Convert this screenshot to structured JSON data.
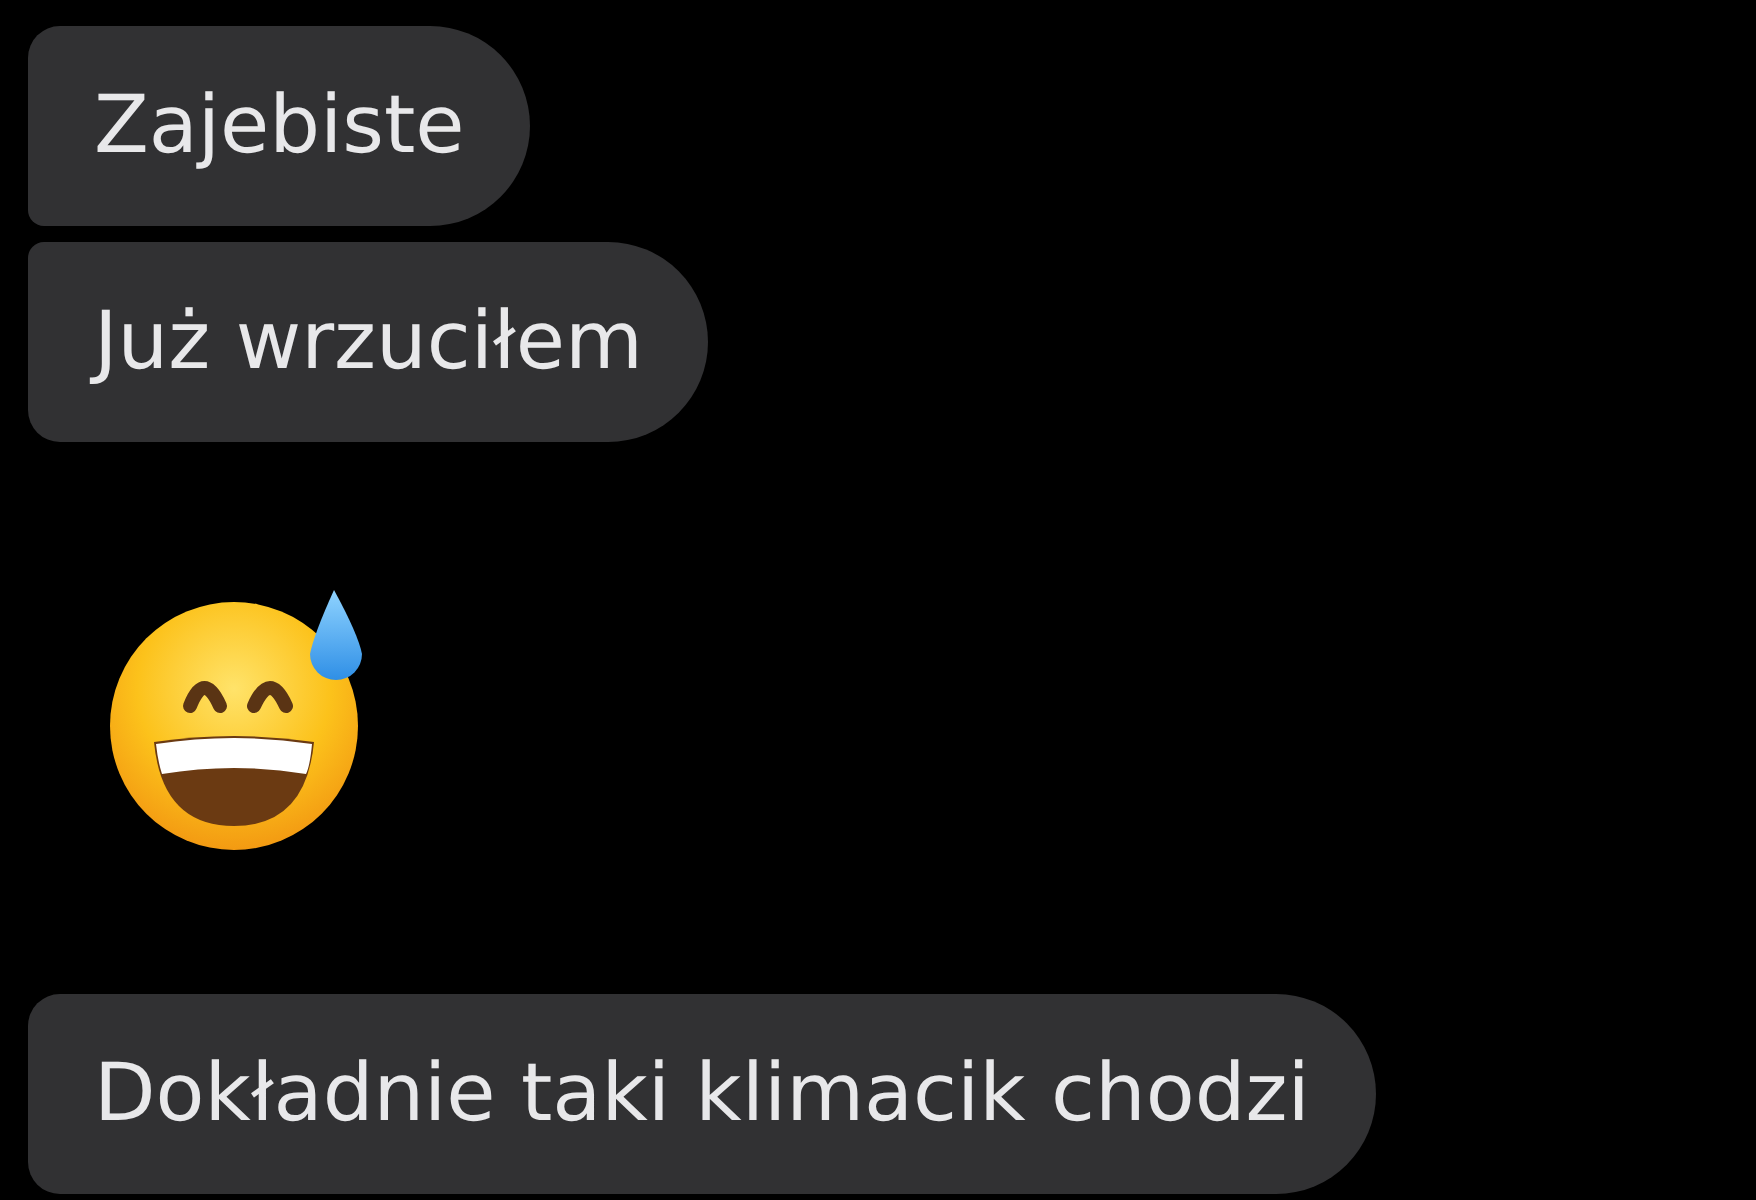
{
  "messages": [
    {
      "kind": "text",
      "text": "Zajebiste"
    },
    {
      "kind": "text",
      "text": "Już wrzuciłem"
    },
    {
      "kind": "emoji"
    },
    {
      "kind": "text",
      "text": "Dokładnie taki klimacik chodzi"
    }
  ]
}
